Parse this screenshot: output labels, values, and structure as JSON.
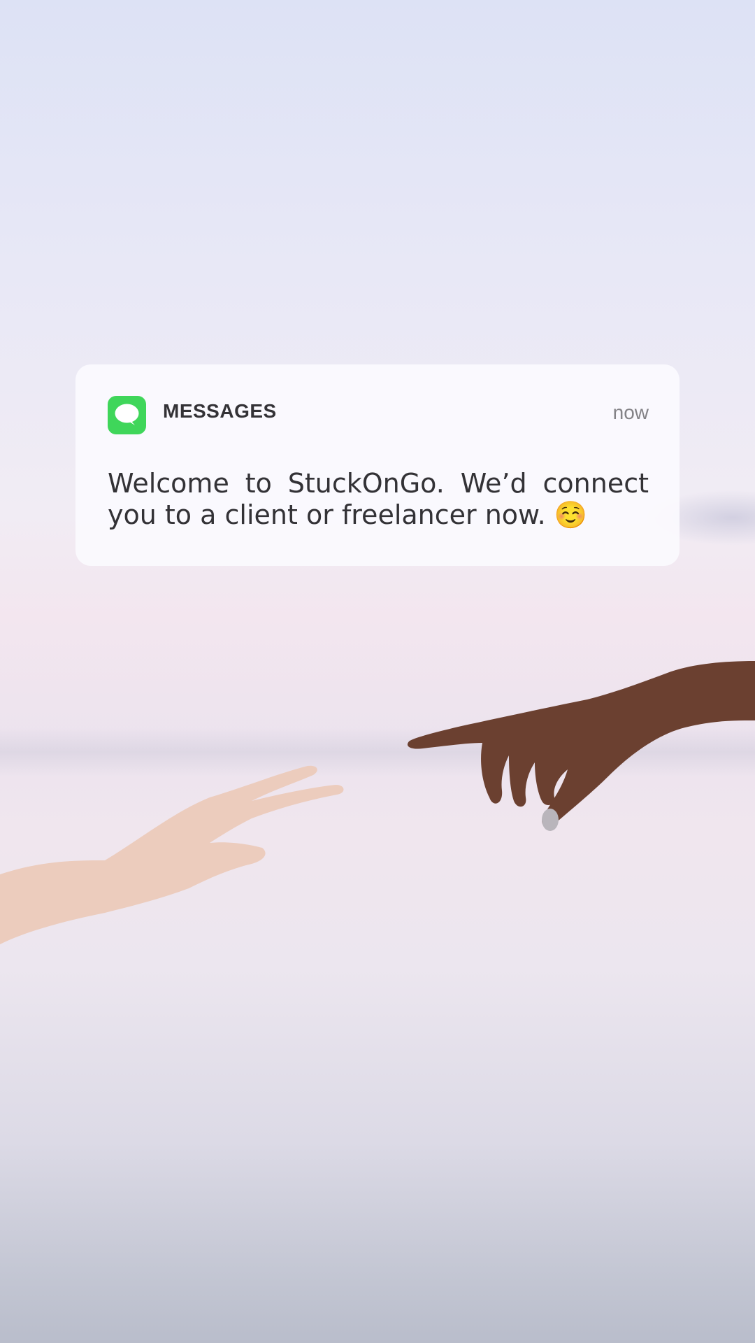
{
  "notification": {
    "app_name": "MESSAGES",
    "app_icon": "messages-bubble-icon",
    "timestamp": "now",
    "body": "Welcome to StuckOnGo. We’d connect you to a client or freelancer now. ☺️"
  },
  "colors": {
    "app_icon_bg": "#3fd65a",
    "card_bg": "#fbfafe",
    "text_primary": "#333236",
    "text_secondary": "#838286"
  }
}
